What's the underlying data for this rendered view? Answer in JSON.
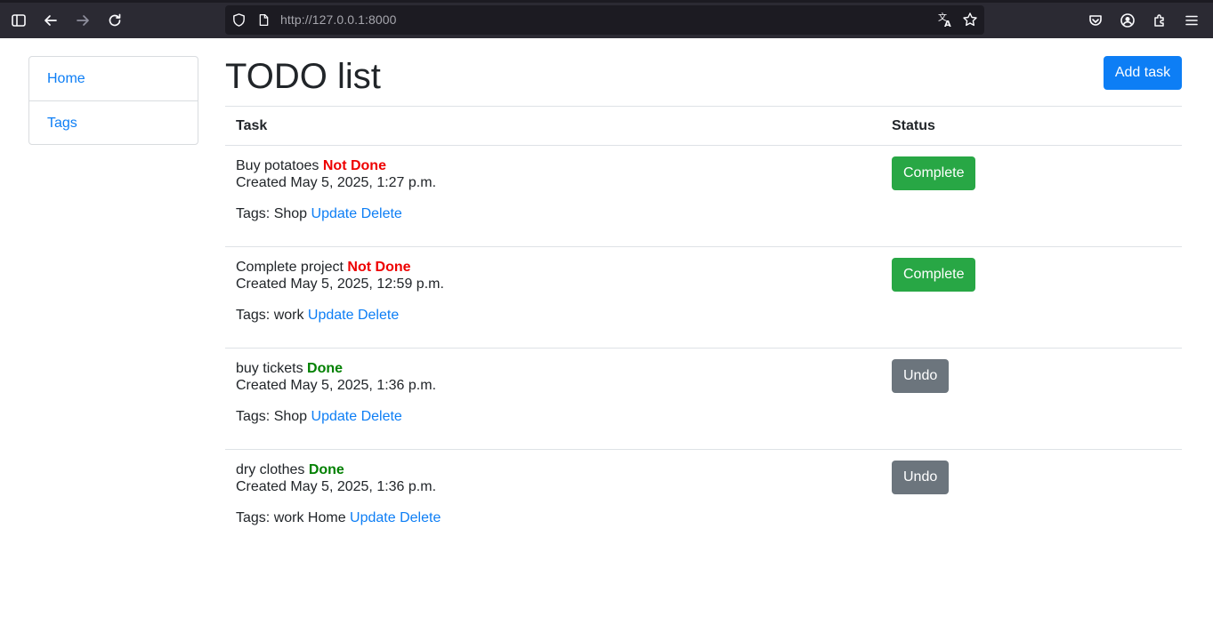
{
  "browser": {
    "url_host": "http://127.0.0.1",
    "url_port": ":8000"
  },
  "sidebar": {
    "items": [
      {
        "label": "Home"
      },
      {
        "label": "Tags"
      }
    ]
  },
  "main": {
    "title": "TODO list",
    "add_label": "Add task",
    "headers": {
      "task": "Task",
      "status": "Status"
    },
    "tasks": [
      {
        "name": "Buy potatoes",
        "state": "Not Done",
        "created": "Created May 5, 2025, 1:27 p.m.",
        "tags": "Tags: Shop",
        "update": "Update",
        "delete": "Delete",
        "action": "Complete"
      },
      {
        "name": "Complete project",
        "state": "Not Done",
        "created": "Created May 5, 2025, 12:59 p.m.",
        "tags": "Tags: work",
        "update": "Update",
        "delete": "Delete",
        "action": "Complete"
      },
      {
        "name": "buy tickets",
        "state": "Done",
        "created": "Created May 5, 2025, 1:36 p.m.",
        "tags": "Tags: Shop",
        "update": "Update",
        "delete": "Delete",
        "action": "Undo"
      },
      {
        "name": "dry clothes",
        "state": "Done",
        "created": "Created May 5, 2025, 1:36 p.m.",
        "tags": "Tags: work Home",
        "update": "Update",
        "delete": "Delete",
        "action": "Undo"
      }
    ]
  },
  "colors": {
    "link": "#0d7ef5",
    "not_done": "#ee0000",
    "done": "#008000",
    "complete_button": "#28a745",
    "undo_button": "#6c757d",
    "toolbar": "#2b2a33"
  },
  "icons": [
    "sidebar-toggle-icon",
    "back-arrow-icon",
    "forward-arrow-icon",
    "reload-icon",
    "shield-icon",
    "page-icon",
    "translate-icon",
    "star-icon",
    "pocket-icon",
    "account-icon",
    "extensions-icon",
    "menu-icon"
  ]
}
